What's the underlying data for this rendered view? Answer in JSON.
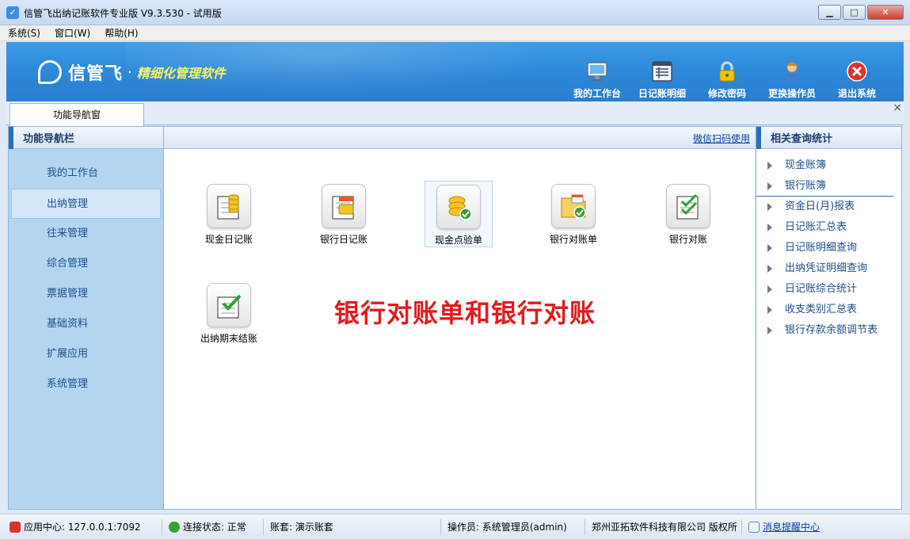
{
  "window": {
    "title": "信管飞出纳记账软件专业版 V9.3.530 - 试用版",
    "buttons": {
      "minimize": "▁",
      "maximize": "□",
      "close": "✕"
    }
  },
  "menu": [
    {
      "label": "系统(S)"
    },
    {
      "label": "窗口(W)"
    },
    {
      "label": "帮助(H)"
    }
  ],
  "banner": {
    "brand_name": "信管飞",
    "dot": "·",
    "slogan": "精细化管理软件",
    "tools": [
      {
        "label": "我的工作台",
        "icon": "monitor-icon"
      },
      {
        "label": "日记账明细",
        "icon": "ledger-icon"
      },
      {
        "label": "修改密码",
        "icon": "lock-icon"
      },
      {
        "label": "更换操作员",
        "icon": "user-icon"
      },
      {
        "label": "退出系统",
        "icon": "exit-icon"
      }
    ]
  },
  "tabs": [
    {
      "label": "功能导航窗"
    }
  ],
  "tab_close": "×",
  "left_panel": {
    "title": "功能导航栏",
    "items": [
      {
        "label": "我的工作台"
      },
      {
        "label": "出纳管理",
        "active": true
      },
      {
        "label": "往来管理"
      },
      {
        "label": "综合管理"
      },
      {
        "label": "票据管理"
      },
      {
        "label": "基础资料"
      },
      {
        "label": "扩展应用"
      },
      {
        "label": "系统管理"
      }
    ]
  },
  "main": {
    "wechat_link": "微信扫码使用",
    "functions": [
      {
        "label": "现金日记账",
        "icon": "cash-journal-icon"
      },
      {
        "label": "银行日记账",
        "icon": "bank-journal-icon"
      },
      {
        "label": "现金点验单",
        "icon": "cash-check-icon"
      },
      {
        "label": "银行对账单",
        "icon": "bank-statement-icon"
      },
      {
        "label": "银行对账",
        "icon": "bank-reconcile-icon"
      },
      {
        "label": "出纳期末结账",
        "icon": "period-close-icon"
      }
    ],
    "annotation": "银行对账单和银行对账"
  },
  "right_panel": {
    "title": "相关查询统计",
    "items": [
      {
        "label": "现金账簿"
      },
      {
        "label": "银行账簿"
      },
      {
        "label": "资金日(月)报表"
      },
      {
        "label": "日记账汇总表"
      },
      {
        "label": "日记账明细查询"
      },
      {
        "label": "出纳凭证明细查询"
      },
      {
        "label": "日记账综合统计"
      },
      {
        "label": "收支类别汇总表"
      },
      {
        "label": "银行存款余额调节表"
      }
    ]
  },
  "status": {
    "app_center": "应用中心: 127.0.0.1:7092",
    "connection": "连接状态: 正常",
    "account_set": "账套: 演示账套",
    "operator": "操作员: 系统管理员(admin)",
    "company": "郑州亚拓软件科技有限公司 版权所",
    "message_center": "消息提醒中心"
  },
  "colors": {
    "banner_blue": "#2d86d8",
    "slogan_yellow": "#f5f26b",
    "annotation_red": "#e31b1b",
    "nav_bg": "#b3d5ef"
  }
}
